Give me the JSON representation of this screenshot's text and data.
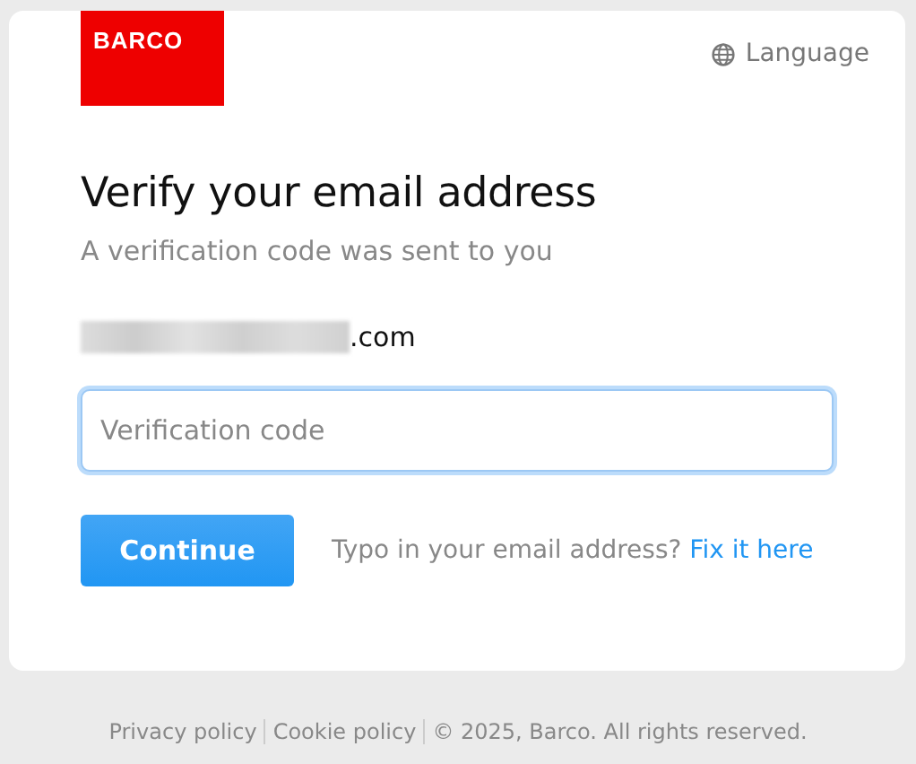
{
  "logo": {
    "text": "BARCO"
  },
  "language": {
    "label": "Language"
  },
  "heading": "Verify your email address",
  "subtitle": "A verification code was sent to you",
  "email": {
    "visible_text": ".com",
    "redacted": true
  },
  "code_field": {
    "placeholder": "Verification code",
    "focused": true
  },
  "continue_button": {
    "label": "Continue"
  },
  "typo_prompt": {
    "text": "Typo in your email address?",
    "link": "Fix it here"
  },
  "footer": {
    "links": [
      "Privacy policy",
      "Cookie policy"
    ],
    "copyright": "© 2025, Barco. All rights reserved."
  }
}
